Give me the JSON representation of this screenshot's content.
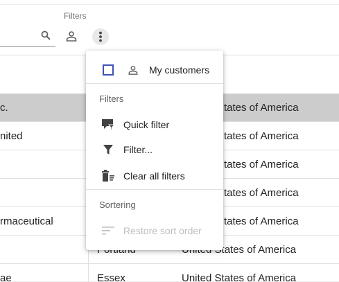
{
  "toolbar": {
    "filters_label": "Filters",
    "icons": [
      "search-icon",
      "person-icon",
      "more-vert-icon"
    ]
  },
  "table": {
    "rows": [
      {
        "name": "c.",
        "city": "",
        "country": "",
        "selected": true
      },
      {
        "name": "nited",
        "city": "",
        "country": ""
      },
      {
        "name": "",
        "city": "",
        "country": ""
      },
      {
        "name": "",
        "city": "",
        "country": ""
      },
      {
        "name": "rmaceutical",
        "city": "",
        "country": ""
      },
      {
        "name": "",
        "city": "Portland",
        "country": "United States of America"
      },
      {
        "name": "ae",
        "city": "Essex",
        "country": "United States of America"
      }
    ],
    "partial_country": [
      "tates of America",
      "tates of America",
      "tates of America",
      "tates of America",
      "tates of America",
      "tates of America"
    ]
  },
  "menu": {
    "my_customers": {
      "label": "My customers",
      "checked": false,
      "icon": "person-icon"
    },
    "filters_header": "Filters",
    "quick_filter": {
      "label": "Quick filter",
      "icon": "quick-filter-icon"
    },
    "filter": {
      "label": "Filter...",
      "icon": "funnel-icon"
    },
    "clear_filters": {
      "label": "Clear all filters",
      "icon": "clear-filters-icon"
    },
    "sorting_header": "Sortering",
    "restore_sort": {
      "label": "Restore sort order",
      "icon": "sort-icon",
      "disabled": true
    }
  },
  "colors": {
    "accent": "#3f51b5",
    "selected_row": "#cccccc",
    "disabled_text": "#bdbdbd"
  }
}
